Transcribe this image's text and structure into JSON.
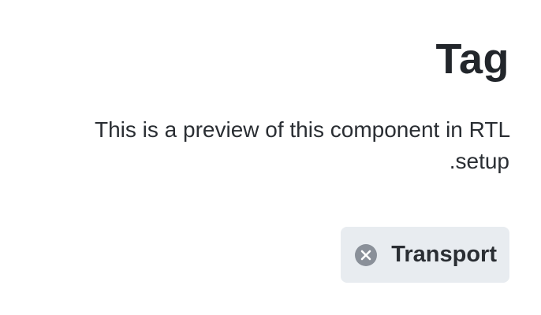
{
  "header": {
    "title": "Tag"
  },
  "description": "This is a preview of this component in RTL setup.",
  "tag": {
    "label": "Transport",
    "remove_icon": "close-circle-icon"
  },
  "colors": {
    "tag_background": "#e8ecf0",
    "remove_icon": "#8a9099",
    "text": "#22262b"
  }
}
